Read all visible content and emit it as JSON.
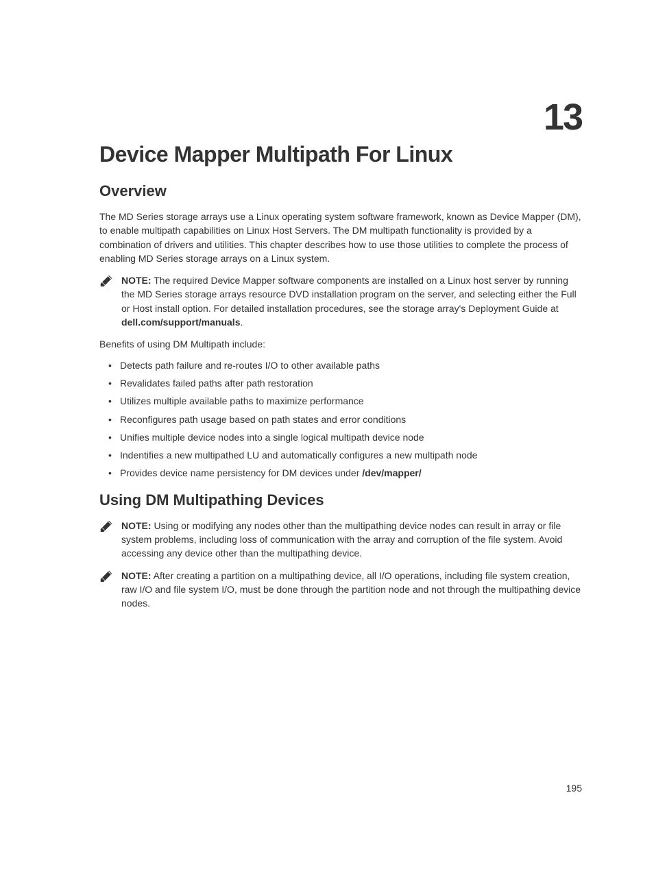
{
  "chapter": {
    "number": "13",
    "title": "Device Mapper Multipath For Linux"
  },
  "section1": {
    "title": "Overview",
    "paragraph1": "The MD Series storage arrays use a Linux operating system software framework, known as Device Mapper (DM), to enable multipath capabilities on Linux Host Servers. The DM multipath functionality is provided by a combination of drivers and utilities. This chapter describes how to use those utilities to complete the process of enabling MD Series storage arrays on a Linux system.",
    "note1": {
      "label": "NOTE:",
      "text_before": " The required Device Mapper software components are installed on a Linux host server by running the MD Series storage arrays resource DVD installation program on the server, and selecting either the Full or Host install option. For detailed installation procedures, see the storage array's Deployment Guide at ",
      "bold_link": "dell.com/support/manuals",
      "text_after": "."
    },
    "benefits_intro": "Benefits of using DM Multipath include:",
    "bullets": [
      "Detects path failure and re-routes I/O to other available paths",
      "Revalidates failed paths after path restoration",
      "Utilizes multiple available paths to maximize performance",
      "Reconfigures path usage based on path states and error conditions",
      "Unifies multiple device nodes into a single logical multipath device node",
      "Indentifies a new multipathed LU and automatically configures a new multipath node"
    ],
    "bullet7_before": "Provides device name persistency for DM devices under ",
    "bullet7_bold": "/dev/mapper/"
  },
  "section2": {
    "title": "Using DM Multipathing Devices",
    "note1": {
      "label": "NOTE:",
      "text": " Using or modifying any nodes other than the multipathing device nodes can result in array or file system problems, including loss of communication with the array and corruption of the file system. Avoid accessing any device other than the multipathing device."
    },
    "note2": {
      "label": "NOTE:",
      "text": " After creating a partition on a multipathing device, all I/O operations, including file system creation, raw I/O and file system I/O, must be done through the partition node and not through the multipathing device nodes."
    }
  },
  "page_number": "195"
}
